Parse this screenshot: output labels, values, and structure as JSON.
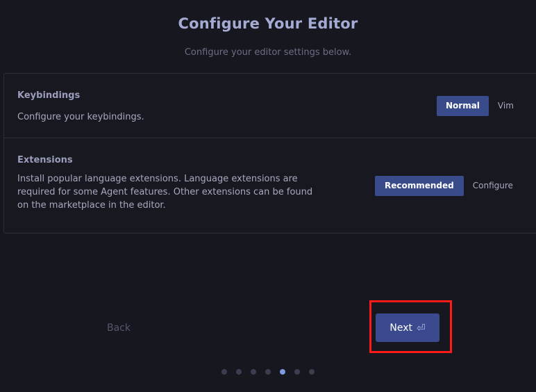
{
  "header": {
    "title": "Configure Your Editor",
    "subtitle": "Configure your editor settings below."
  },
  "settings": {
    "keybindings": {
      "title": "Keybindings",
      "description": "Configure your keybindings.",
      "options": [
        "Normal",
        "Vim"
      ],
      "selected": "Normal"
    },
    "extensions": {
      "title": "Extensions",
      "description": "Install popular language extensions. Language extensions are required for some Agent features. Other extensions can be found on the marketplace in the editor.",
      "options": [
        "Recommended",
        "Configure"
      ],
      "selected": "Recommended"
    }
  },
  "nav": {
    "back_label": "Back",
    "next_label": "Next",
    "next_icon": "enter-icon",
    "enter_glyph": "⏎"
  },
  "progress": {
    "total_steps": 7,
    "current_step": 5
  },
  "colors": {
    "accent": "#3b4a8e",
    "highlight": "#ff1a1a",
    "active_dot": "#7c9be0"
  }
}
